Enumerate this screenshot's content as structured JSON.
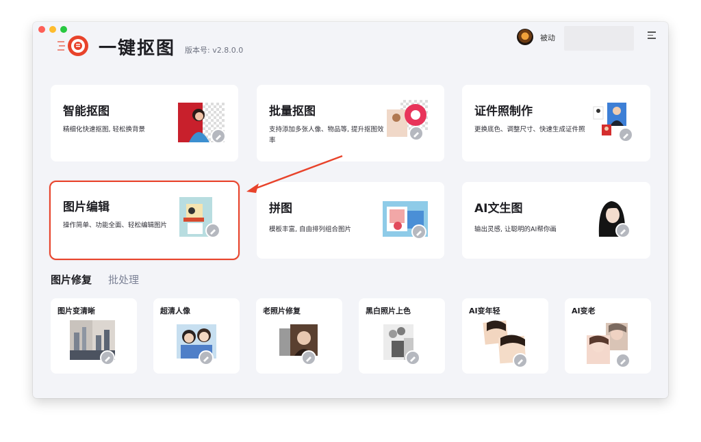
{
  "window": {
    "app_title": "一键抠图",
    "version": "版本号: v2.8.0.0",
    "username": "被动",
    "accent": "#e8432b"
  },
  "features": [
    {
      "title": "智能抠图",
      "desc": "精细化快速抠图, 轻松换背景"
    },
    {
      "title": "批量抠图",
      "desc": "支持添加多张人像、物品等, 提升抠图效率"
    },
    {
      "title": "证件照制作",
      "desc": "更换底色、调整尺寸、快速生成证件照"
    },
    {
      "title": "图片编辑",
      "desc": "操作简单、功能全面、轻松编辑图片"
    },
    {
      "title": "拼图",
      "desc": "模板丰富, 自由排列组合图片"
    },
    {
      "title": "AI文生图",
      "desc": "输出灵感, 让聪明的AI帮你画"
    }
  ],
  "tabs": [
    "图片修复",
    "批处理"
  ],
  "repair_tools": [
    {
      "title": "图片变清晰"
    },
    {
      "title": "超清人像"
    },
    {
      "title": "老照片修复"
    },
    {
      "title": "黑白照片上色"
    },
    {
      "title": "AI变年轻"
    },
    {
      "title": "AI变老"
    }
  ],
  "icons": {
    "badge": "brush-icon",
    "menu": "menu-icon",
    "logo": "app-logo"
  }
}
